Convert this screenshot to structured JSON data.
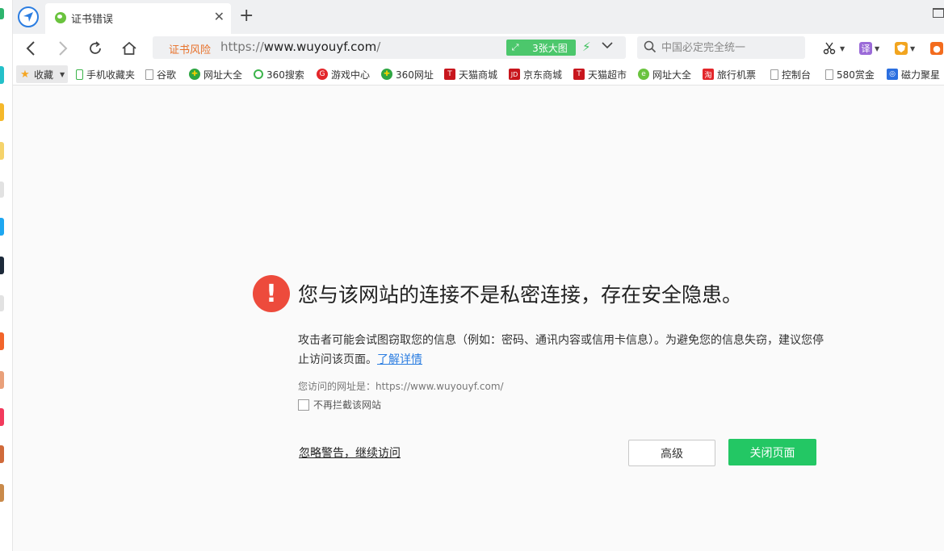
{
  "tab": {
    "title": "证书错误"
  },
  "address_bar": {
    "warning": "证书风险",
    "url_prefix": "https://",
    "url_domain": "www.wuyouyf.com",
    "url_suffix": "/",
    "image_badge": "3张大图"
  },
  "search": {
    "placeholder": "中国必定完全统一"
  },
  "extensions": {
    "translate": "译"
  },
  "bookmarks": [
    {
      "label": "收藏",
      "icon": "star-icon"
    },
    {
      "label": "手机收藏夹",
      "icon": "phone-icon"
    },
    {
      "label": "谷歌",
      "icon": "page-icon"
    },
    {
      "label": "网址大全",
      "icon": "360-icon"
    },
    {
      "label": "360搜索",
      "icon": "search-360-icon"
    },
    {
      "label": "游戏中心",
      "icon": "game-icon"
    },
    {
      "label": "360网址",
      "icon": "360-icon"
    },
    {
      "label": "天猫商城",
      "icon": "tmall-icon"
    },
    {
      "label": "京东商城",
      "icon": "jd-icon"
    },
    {
      "label": "天猫超市",
      "icon": "tmall-icon"
    },
    {
      "label": "网址大全",
      "icon": "ie-icon"
    },
    {
      "label": "旅行机票",
      "icon": "travel-icon"
    },
    {
      "label": "控制台",
      "icon": "page-icon"
    },
    {
      "label": "580赏金",
      "icon": "page-icon"
    },
    {
      "label": "磁力聚星",
      "icon": "magnet-icon"
    }
  ],
  "error_page": {
    "headline": "您与该网站的连接不是私密连接，存在安全隐患。",
    "description": "攻击者可能会试图窃取您的信息（例如：密码、通讯内容或信用卡信息）。为避免您的信息失窃，建议您停止访问该页面。",
    "learn_more": "了解详情",
    "visited_url": "您访问的网址是：https://www.wuyouyf.com/",
    "dont_block": "不再拦截该网站",
    "ignore_link": "忽略警告，继续访问",
    "advanced_button": "高级",
    "close_button": "关闭页面"
  },
  "colors": {
    "error_red": "#ed4b3c",
    "close_green": "#23c764",
    "link_blue": "#2b7de1",
    "warning_orange": "#e8712a"
  }
}
